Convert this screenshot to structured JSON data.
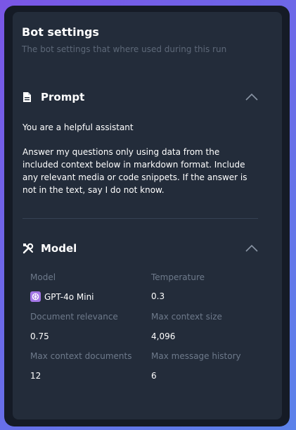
{
  "header": {
    "title": "Bot settings",
    "subtitle": "The bot settings that where used during this run"
  },
  "prompt_section": {
    "label": "Prompt",
    "icon": "document-icon",
    "line1": "You are a helpful assistant",
    "line2": "Answer my questions only using data from the included context below in markdown format. Include any relevant media or code snippets. If the answer is not in the text, say I do not know."
  },
  "model_section": {
    "label": "Model",
    "icon": "tools-icon",
    "fields": {
      "model": {
        "label": "Model",
        "value": "GPT-4o Mini",
        "icon": "openai-icon"
      },
      "temperature": {
        "label": "Temperature",
        "value": "0.3"
      },
      "document_relevance": {
        "label": "Document relevance",
        "value": "0.75"
      },
      "max_context_size": {
        "label": "Max context size",
        "value": "4,096"
      },
      "max_context_documents": {
        "label": "Max context documents",
        "value": "12"
      },
      "max_message_history": {
        "label": "Max message history",
        "value": "6"
      }
    }
  },
  "colors": {
    "panel": "#232c3a",
    "frame": "#151b26",
    "model_badge": "#a477e6"
  }
}
